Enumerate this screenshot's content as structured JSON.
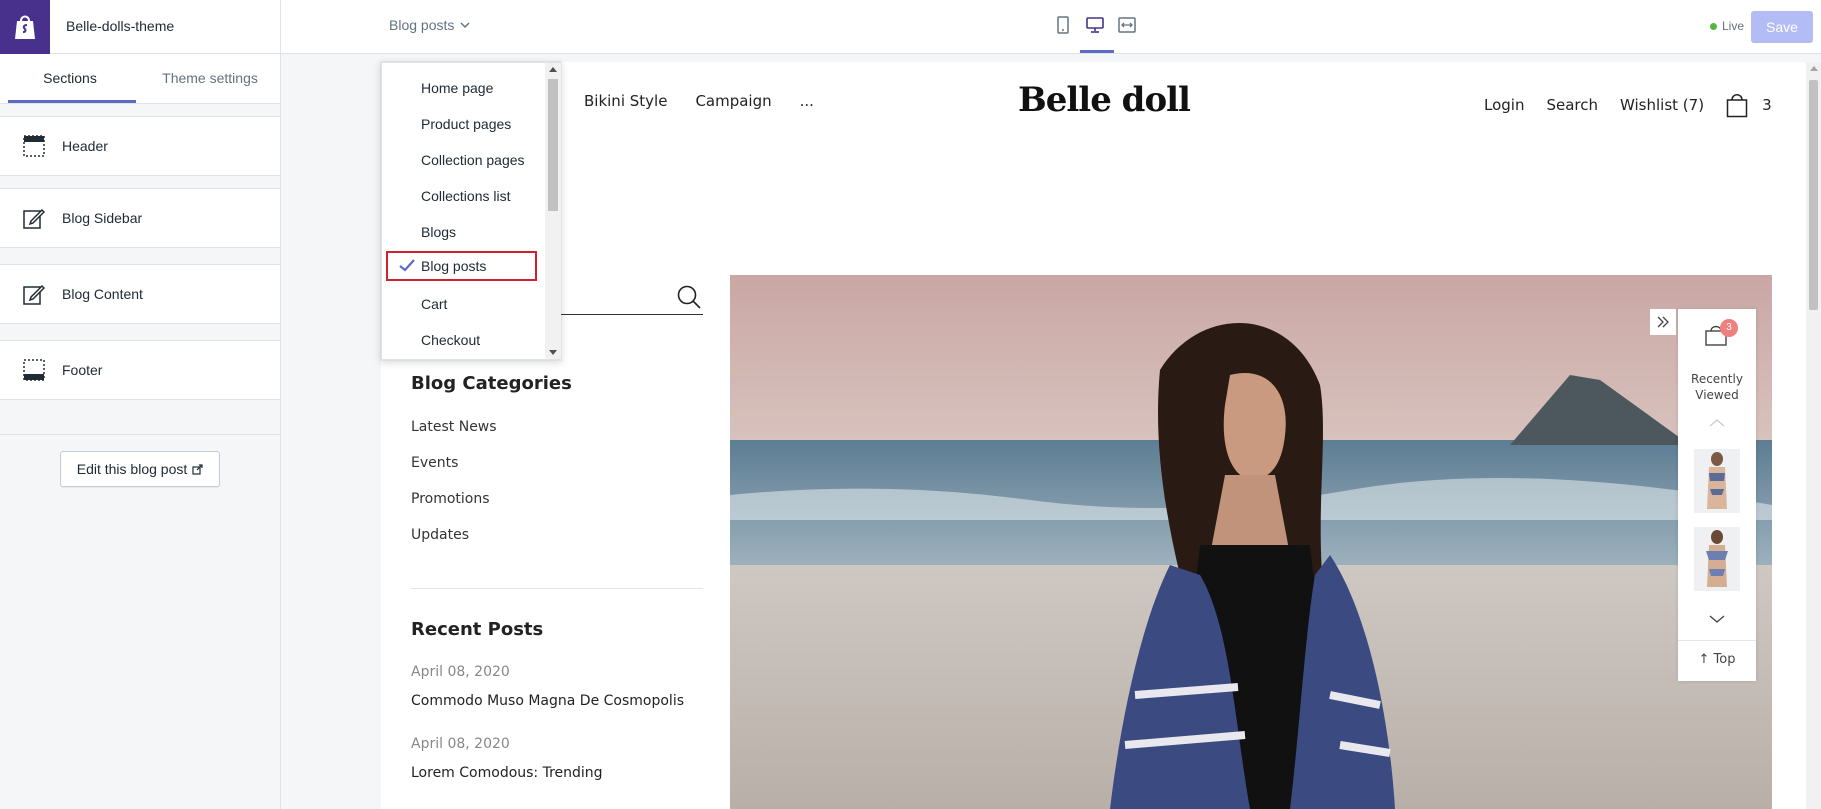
{
  "app": {
    "theme_name": "Belle-dolls-theme",
    "accent_color": "#5c6ac4",
    "brand_color": "#47318c"
  },
  "topbar": {
    "page_select_label": "Blog posts",
    "view_icons": [
      "mobile-view-icon",
      "desktop-view-icon",
      "fullscreen-view-icon"
    ],
    "live_label": "Live",
    "save_label": "Save"
  },
  "sidebar": {
    "tabs": [
      {
        "label": "Sections",
        "active": true
      },
      {
        "label": "Theme settings",
        "active": false
      }
    ],
    "sections": [
      {
        "label": "Header",
        "icon": "header-layout-icon"
      },
      {
        "label": "Blog Sidebar",
        "icon": "edit-icon"
      },
      {
        "label": "Blog Content",
        "icon": "edit-icon"
      },
      {
        "label": "Footer",
        "icon": "footer-layout-icon"
      }
    ],
    "edit_button_label": "Edit this blog post"
  },
  "dropdown": {
    "items": [
      "Home page",
      "Product pages",
      "Collection pages",
      "Collections list",
      "Blogs",
      "Blog posts",
      "Cart",
      "Checkout"
    ],
    "selected": "Blog posts"
  },
  "store": {
    "brand": "Belle doll",
    "nav_left": [
      "Bikini Style",
      "Campaign",
      "..."
    ],
    "nav_right": {
      "login": "Login",
      "search": "Search",
      "wishlist": "Wishlist (7)",
      "cart_count": "3"
    },
    "blog_categories_heading": "Blog Categories",
    "blog_categories": [
      "Latest News",
      "Events",
      "Promotions",
      "Updates"
    ],
    "recent_posts_heading": "Recent Posts",
    "recent_posts": [
      {
        "date": "April 08, 2020",
        "title": "Commodo Muso Magna De Cosmopolis"
      },
      {
        "date": "April 08, 2020",
        "title": "Lorem Comodous: Trending"
      }
    ],
    "recently_viewed": {
      "badge": "3",
      "title_line1": "Recently",
      "title_line2": "Viewed",
      "top_label": "Top"
    }
  }
}
